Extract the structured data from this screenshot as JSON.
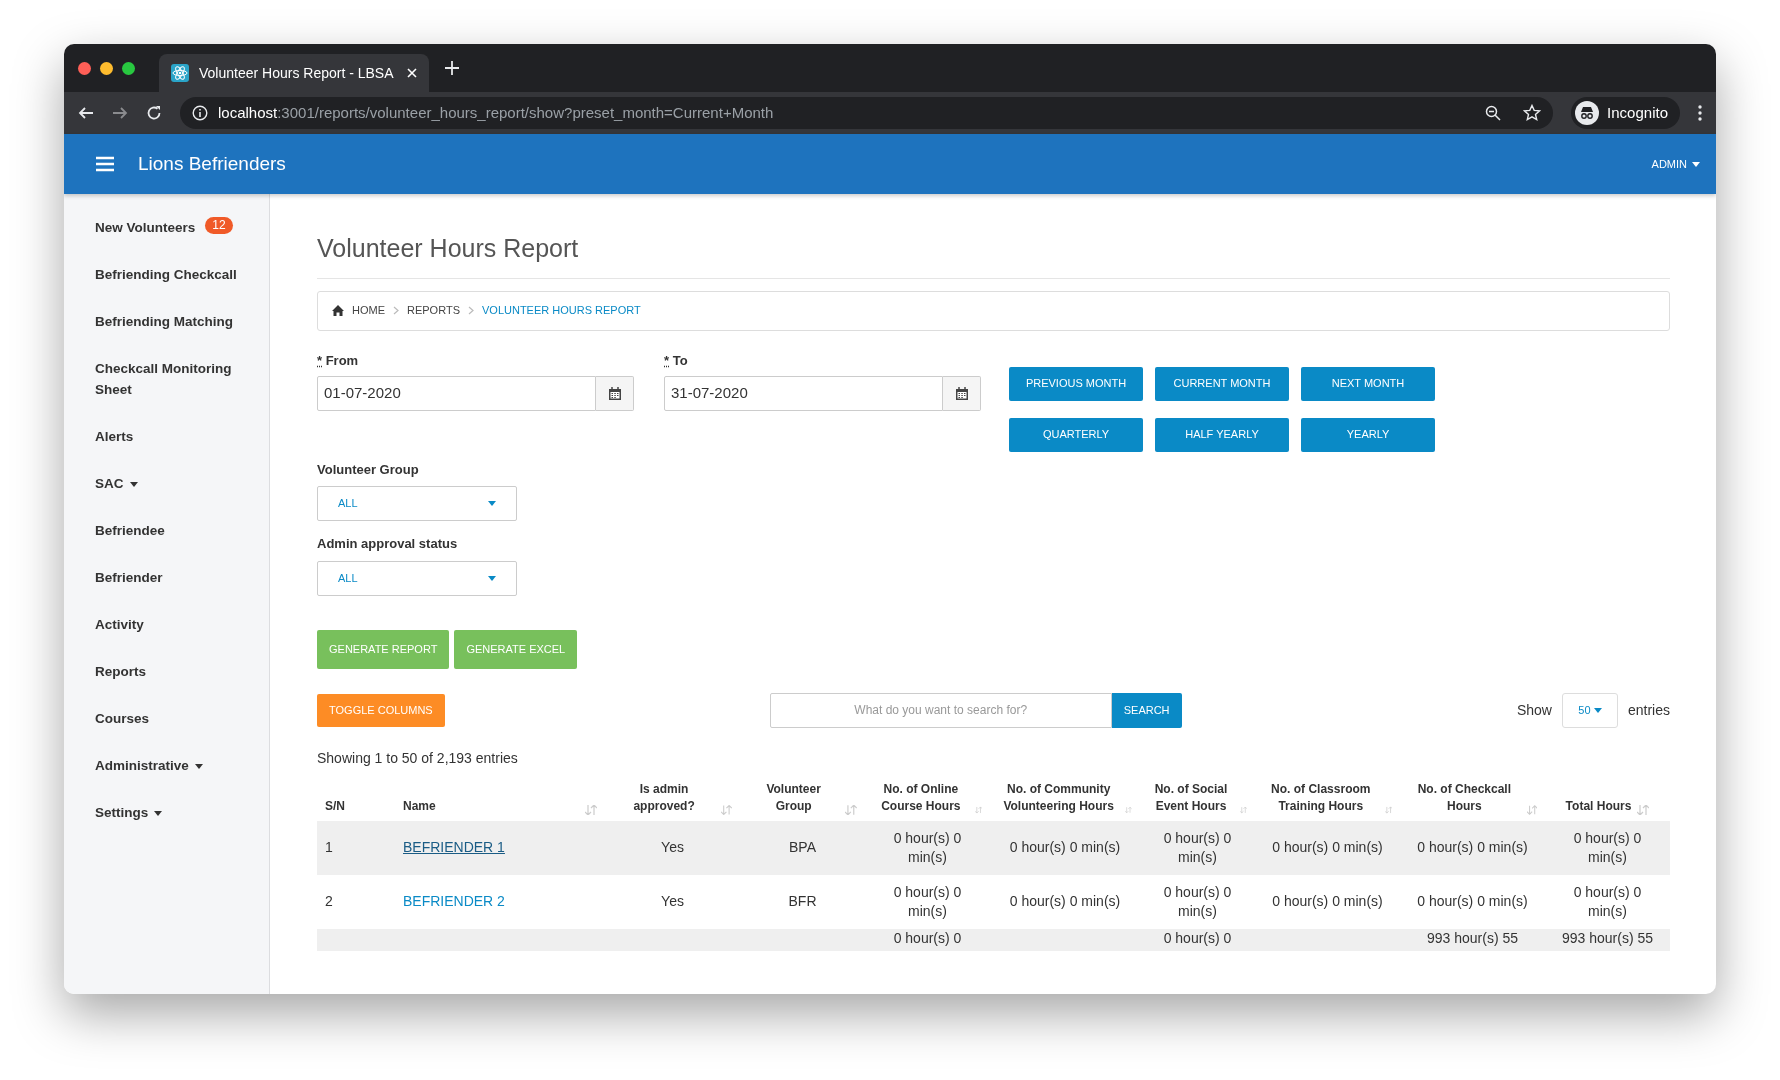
{
  "browser": {
    "tab_title": "Volunteer Hours Report - LBSA",
    "url_host": "localhost",
    "url_path": ":3001/reports/volunteer_hours_report/show?preset_month=Current+Month",
    "profile_label": "Incognito"
  },
  "app": {
    "brand": "Lions Befrienders",
    "user_menu": "ADMIN"
  },
  "sidebar": {
    "items": [
      {
        "label": "New Volunteers",
        "badge": "12",
        "has_submenu": false
      },
      {
        "label": "Befriending Checkcall",
        "has_submenu": false
      },
      {
        "label": "Befriending Matching",
        "has_submenu": false
      },
      {
        "label": "Checkcall Monitoring Sheet",
        "has_submenu": false
      },
      {
        "label": "Alerts",
        "has_submenu": false
      },
      {
        "label": "SAC",
        "has_submenu": true
      },
      {
        "label": "Befriendee",
        "has_submenu": false
      },
      {
        "label": "Befriender",
        "has_submenu": false
      },
      {
        "label": "Activity",
        "has_submenu": false
      },
      {
        "label": "Reports",
        "has_submenu": false
      },
      {
        "label": "Courses",
        "has_submenu": false
      },
      {
        "label": "Administrative",
        "has_submenu": true
      },
      {
        "label": "Settings",
        "has_submenu": true
      }
    ]
  },
  "page_title": "Volunteer Hours Report",
  "breadcrumb": [
    {
      "label": "HOME",
      "current": false
    },
    {
      "label": "REPORTS",
      "current": false
    },
    {
      "label": "VOLUNTEER HOURS REPORT",
      "current": true
    }
  ],
  "date_fields": [
    {
      "required_mark": "*",
      "label": "From",
      "value": "01-07-2020"
    },
    {
      "required_mark": "*",
      "label": "To",
      "value": "31-07-2020"
    }
  ],
  "preset_buttons": [
    "PREVIOUS MONTH",
    "CURRENT MONTH",
    "NEXT MONTH",
    "QUARTERLY",
    "HALF YEARLY",
    "YEARLY"
  ],
  "filters": [
    {
      "label": "Volunteer Group",
      "value": "ALL"
    },
    {
      "label": "Admin approval status",
      "value": "ALL"
    }
  ],
  "actions": [
    "GENERATE REPORT",
    "GENERATE EXCEL"
  ],
  "toggle_columns": "TOGGLE COLUMNS",
  "search": {
    "placeholder": "What do you want to search for?",
    "button": "SEARCH"
  },
  "page_size": {
    "show_label": "Show",
    "value": "50",
    "entries_label": "entries"
  },
  "info": "Showing 1 to 50 of 2,193 entries",
  "table": {
    "columns": [
      {
        "label": "S/N",
        "sortable": false
      },
      {
        "label": "Name",
        "sortable": true
      },
      {
        "label": "Is admin approved?",
        "sortable": true
      },
      {
        "label": "Volunteer Group",
        "sortable": true
      },
      {
        "label": "No. of Online Course Hours",
        "sortable": true
      },
      {
        "label": "No. of Community Volunteering Hours",
        "sortable": true
      },
      {
        "label": "No. of Social Event Hours",
        "sortable": true
      },
      {
        "label": "No. of Classroom Training Hours",
        "sortable": true
      },
      {
        "label": "No. of Checkcall Hours",
        "sortable": true
      },
      {
        "label": "Total Hours",
        "sortable": true
      }
    ],
    "rows": [
      {
        "cells": [
          "1",
          "BEFRIENDER 1",
          "Yes",
          "BPA",
          "0 hour(s) 0 min(s)",
          "0 hour(s) 0 min(s)",
          "0 hour(s) 0 min(s)",
          "0 hour(s) 0 min(s)",
          "0 hour(s) 0 min(s)",
          "0 hour(s) 0 min(s)"
        ],
        "hovered": true
      },
      {
        "cells": [
          "2",
          "BEFRIENDER 2",
          "Yes",
          "BFR",
          "0 hour(s) 0 min(s)",
          "0 hour(s) 0 min(s)",
          "0 hour(s) 0 min(s)",
          "0 hour(s) 0 min(s)",
          "0 hour(s) 0 min(s)",
          "0 hour(s) 0 min(s)"
        ],
        "hovered": false
      },
      {
        "cells": [
          "",
          "",
          "",
          "",
          "0 hour(s) 0",
          "",
          "0 hour(s) 0",
          "",
          "993 hour(s) 55",
          "993 hour(s) 55"
        ]
      }
    ]
  }
}
